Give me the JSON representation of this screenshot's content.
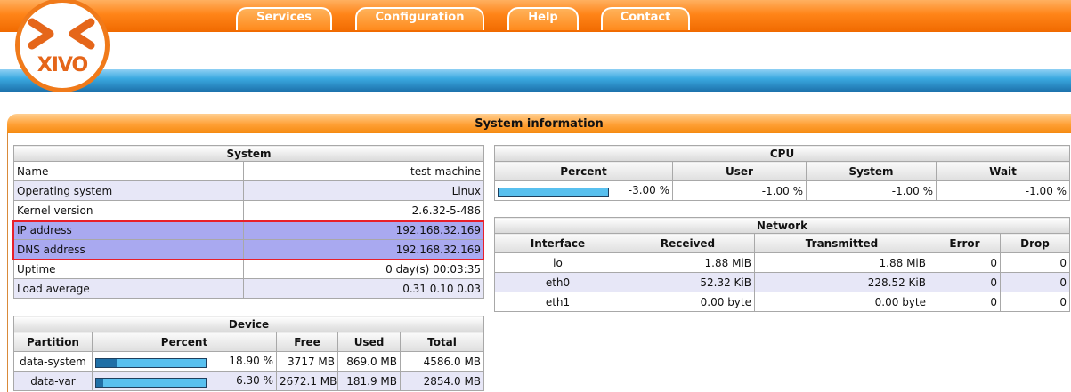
{
  "nav": {
    "tabs": [
      {
        "label": "Services"
      },
      {
        "label": "Configuration"
      },
      {
        "label": "Help"
      },
      {
        "label": "Contact"
      }
    ]
  },
  "logo": {
    "text": "XIVO"
  },
  "section_title": "System information",
  "system": {
    "caption": "System",
    "rows": [
      {
        "label": "Name",
        "value": "test-machine"
      },
      {
        "label": "Operating system",
        "value": "Linux"
      },
      {
        "label": "Kernel version",
        "value": "2.6.32-5-486"
      },
      {
        "label": "IP address",
        "value": "192.168.32.169"
      },
      {
        "label": "DNS address",
        "value": "192.168.32.169"
      },
      {
        "label": "Uptime",
        "value": "0 day(s) 00:03:35"
      },
      {
        "label": "Load average",
        "value": "0.31 0.10 0.03"
      }
    ]
  },
  "device": {
    "caption": "Device",
    "headers": [
      "Partition",
      "Percent",
      "Free",
      "Used",
      "Total"
    ],
    "rows": [
      {
        "partition": "data-system",
        "percent": "18.90 %",
        "percent_value": 18.9,
        "free": "3717 MB",
        "used": "869.0 MB",
        "total": "4586.0 MB"
      },
      {
        "partition": "data-var",
        "percent": "6.30 %",
        "percent_value": 6.3,
        "free": "2672.1 MB",
        "used": "181.9 MB",
        "total": "2854.0 MB"
      }
    ]
  },
  "cpu": {
    "caption": "CPU",
    "headers": [
      "Percent",
      "User",
      "System",
      "Wait"
    ],
    "row": {
      "percent": "-3.00 %",
      "percent_value": 0,
      "user": "-1.00 %",
      "system": "-1.00 %",
      "wait": "-1.00 %"
    }
  },
  "network": {
    "caption": "Network",
    "headers": [
      "Interface",
      "Received",
      "Transmitted",
      "Error",
      "Drop"
    ],
    "rows": [
      {
        "interface": "lo",
        "received": "1.88 MiB",
        "transmitted": "1.88 MiB",
        "error": "0",
        "drop": "0"
      },
      {
        "interface": "eth0",
        "received": "52.32 KiB",
        "transmitted": "228.52 KiB",
        "error": "0",
        "drop": "0"
      },
      {
        "interface": "eth1",
        "received": "0.00 byte",
        "transmitted": "0.00 byte",
        "error": "0",
        "drop": "0"
      }
    ]
  },
  "colors": {
    "header_orange": "#ff8418",
    "header_blue": "#3aa9e0",
    "highlight_row": "#a9a9f0",
    "alt_row": "#e7e7f7",
    "annotation_red": "#e8202a",
    "progress_dark": "#1f6fa6",
    "progress_light": "#58c0ef"
  }
}
